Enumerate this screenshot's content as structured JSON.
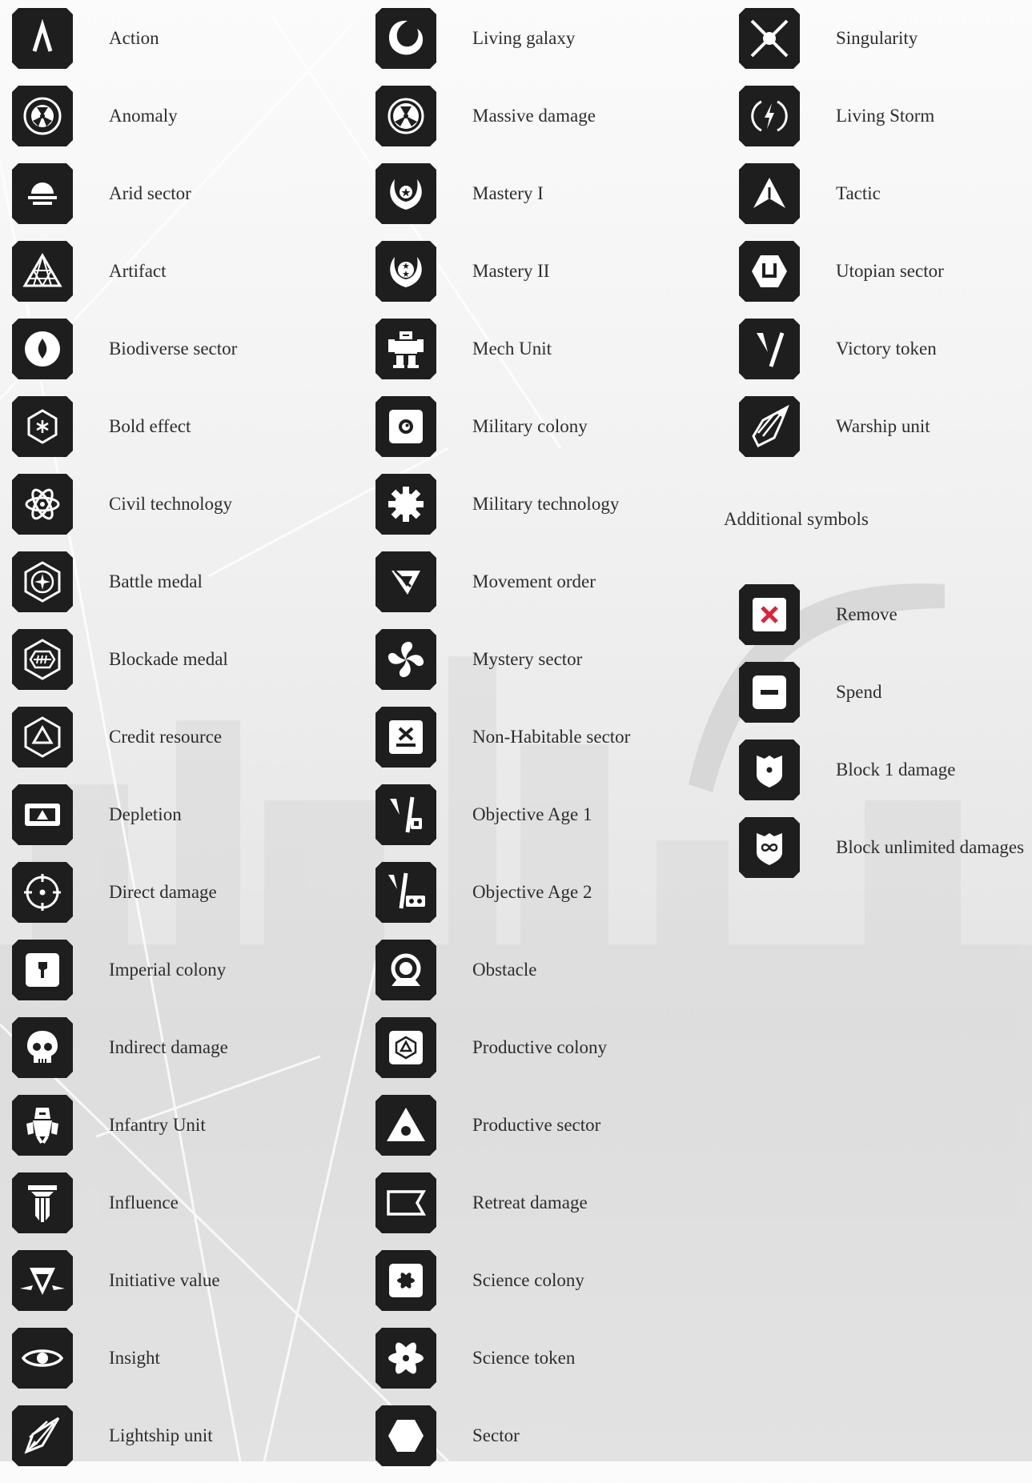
{
  "columns": [
    [
      {
        "label": "Action",
        "icon": "action-icon"
      },
      {
        "label": "Anomaly",
        "icon": "anomaly-icon"
      },
      {
        "label": "Arid sector",
        "icon": "arid-sector-icon"
      },
      {
        "label": "Artifact",
        "icon": "artifact-icon"
      },
      {
        "label": "Biodiverse sector",
        "icon": "biodiverse-sector-icon"
      },
      {
        "label": "Bold effect",
        "icon": "bold-effect-icon"
      },
      {
        "label": "Civil technology",
        "icon": "civil-technology-icon"
      },
      {
        "label": "Battle medal",
        "icon": "battle-medal-icon"
      },
      {
        "label": "Blockade medal",
        "icon": "blockade-medal-icon"
      },
      {
        "label": "Credit resource",
        "icon": "credit-resource-icon"
      },
      {
        "label": "Depletion",
        "icon": "depletion-icon"
      },
      {
        "label": "Direct damage",
        "icon": "direct-damage-icon"
      },
      {
        "label": "Imperial colony",
        "icon": "imperial-colony-icon"
      },
      {
        "label": "Indirect damage",
        "icon": "indirect-damage-icon"
      },
      {
        "label": "Infantry Unit",
        "icon": "infantry-unit-icon"
      },
      {
        "label": "Influence",
        "icon": "influence-icon"
      },
      {
        "label": "Initiative value",
        "icon": "initiative-value-icon"
      },
      {
        "label": "Insight",
        "icon": "insight-icon"
      },
      {
        "label": "Lightship unit",
        "icon": "lightship-unit-icon"
      }
    ],
    [
      {
        "label": "Living galaxy",
        "icon": "living-galaxy-icon"
      },
      {
        "label": "Massive damage",
        "icon": "massive-damage-icon"
      },
      {
        "label": "Mastery I",
        "icon": "mastery-1-icon"
      },
      {
        "label": "Mastery II",
        "icon": "mastery-2-icon"
      },
      {
        "label": "Mech Unit",
        "icon": "mech-unit-icon"
      },
      {
        "label": "Military colony",
        "icon": "military-colony-icon"
      },
      {
        "label": "Military technology",
        "icon": "military-technology-icon"
      },
      {
        "label": "Movement order",
        "icon": "movement-order-icon"
      },
      {
        "label": "Mystery sector",
        "icon": "mystery-sector-icon"
      },
      {
        "label": "Non-Habitable sector",
        "icon": "non-habitable-sector-icon"
      },
      {
        "label": "Objective Age 1",
        "icon": "objective-age-1-icon"
      },
      {
        "label": "Objective Age 2",
        "icon": "objective-age-2-icon"
      },
      {
        "label": "Obstacle",
        "icon": "obstacle-icon"
      },
      {
        "label": "Productive colony",
        "icon": "productive-colony-icon"
      },
      {
        "label": "Productive sector",
        "icon": "productive-sector-icon"
      },
      {
        "label": "Retreat damage",
        "icon": "retreat-damage-icon"
      },
      {
        "label": "Science colony",
        "icon": "science-colony-icon"
      },
      {
        "label": "Science token",
        "icon": "science-token-icon"
      },
      {
        "label": "Sector",
        "icon": "sector-icon"
      }
    ],
    [
      {
        "label": "Singularity",
        "icon": "singularity-icon"
      },
      {
        "label": "Living Storm",
        "icon": "living-storm-icon"
      },
      {
        "label": "Tactic",
        "icon": "tactic-icon"
      },
      {
        "label": "Utopian sector",
        "icon": "utopian-sector-icon"
      },
      {
        "label": "Victory token",
        "icon": "victory-token-icon"
      },
      {
        "label": "Warship unit",
        "icon": "warship-unit-icon"
      }
    ]
  ],
  "additional": {
    "title": "Additional symbols",
    "items": [
      {
        "label": "Remove",
        "icon": "remove-icon"
      },
      {
        "label": "Spend",
        "icon": "spend-icon"
      },
      {
        "label": "Block 1 damage",
        "icon": "block-1-damage-icon"
      },
      {
        "label": "Block unlimited damages",
        "icon": "block-unlimited-damages-icon"
      }
    ]
  },
  "colors": {
    "tile": "#1e1e1e",
    "glyph": "#ffffff",
    "accent": "#e0203a",
    "text": "#2d2d2d"
  }
}
